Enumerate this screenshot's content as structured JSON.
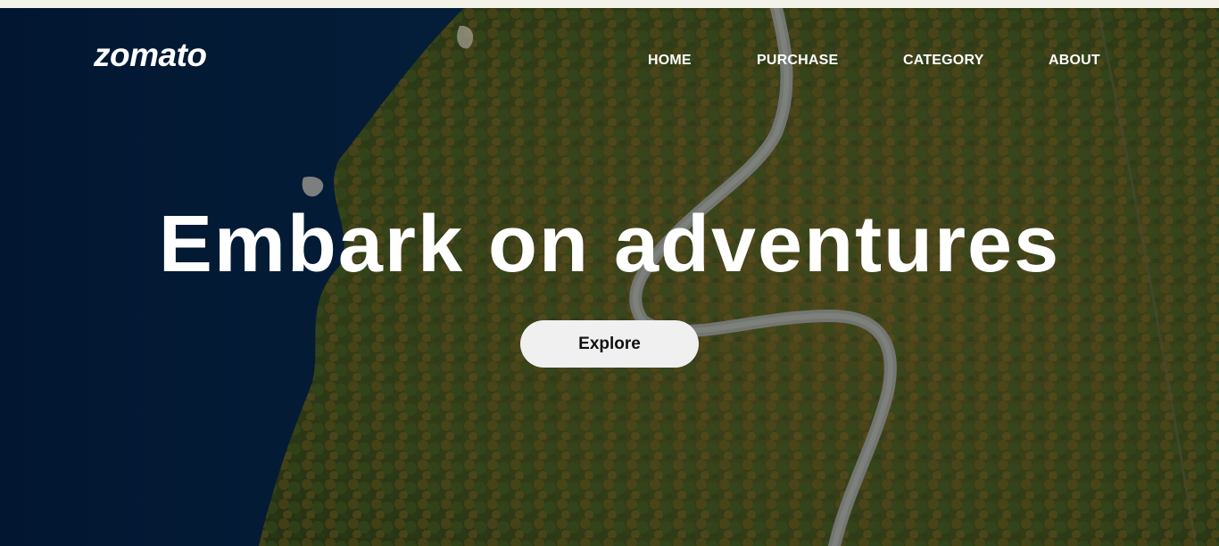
{
  "brand": {
    "logo_text": "zomato"
  },
  "nav": {
    "items": [
      {
        "label": "HOME"
      },
      {
        "label": "PURCHASE"
      },
      {
        "label": "CATEGORY"
      },
      {
        "label": "ABOUT"
      }
    ]
  },
  "hero": {
    "headline": "Embark on adventures",
    "cta_label": "Explore",
    "background": "aerial-coastline-forest-road"
  },
  "colors": {
    "sea": "#082a4a",
    "forest": "#4b4a1f",
    "text": "#ffffff",
    "button_bg": "#f0f0f0",
    "button_text": "#111111"
  }
}
